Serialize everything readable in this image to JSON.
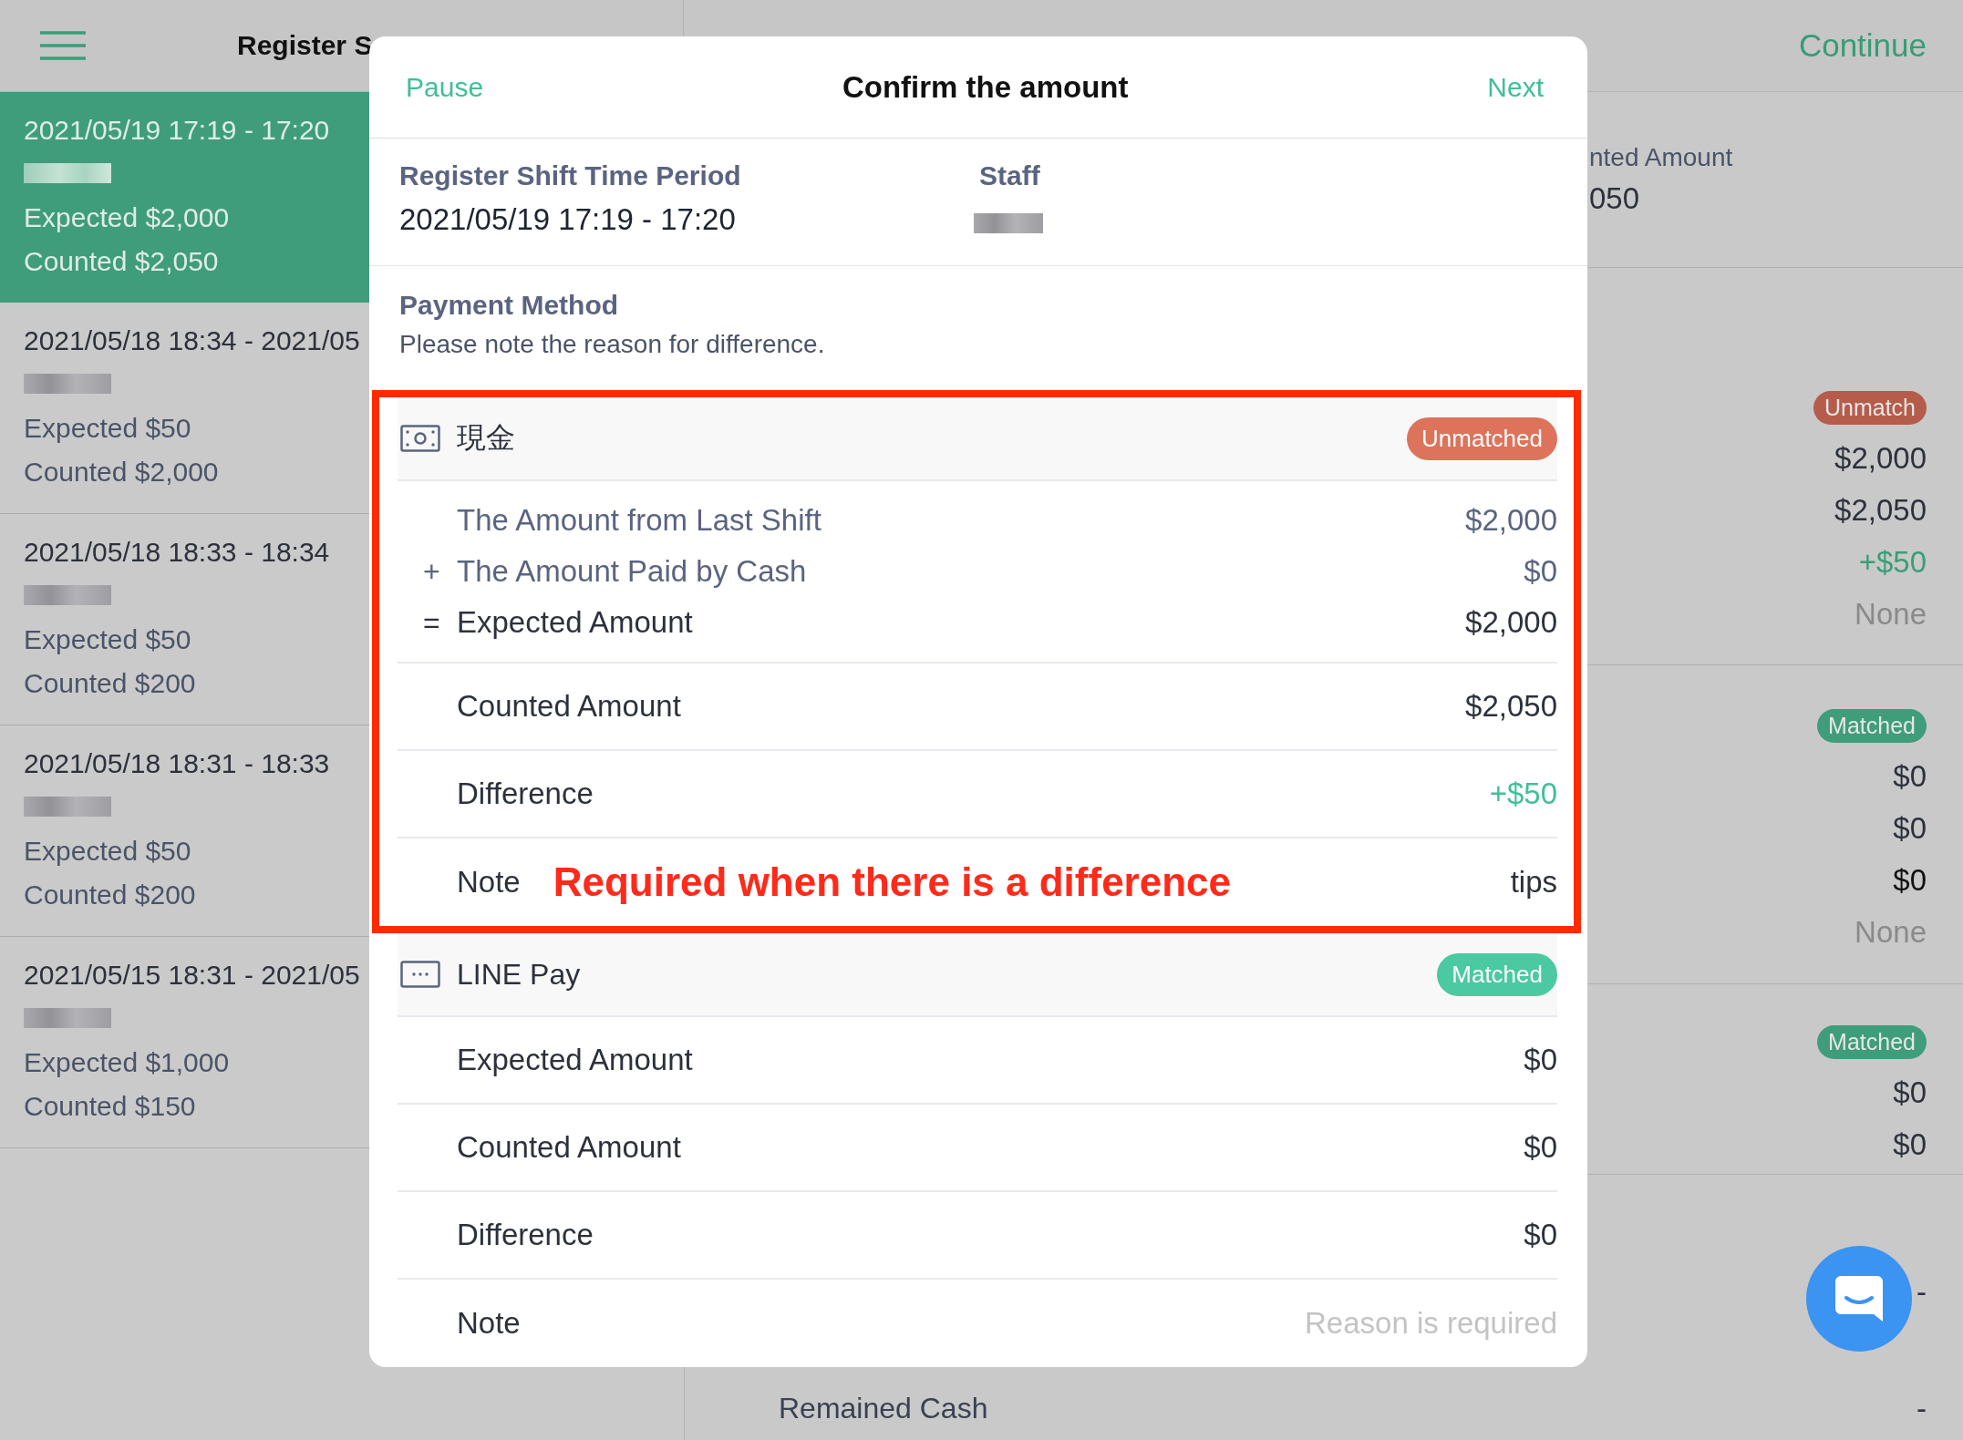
{
  "header": {
    "title": "Register S",
    "action": "Continue"
  },
  "sidebar": {
    "shifts": [
      {
        "period": "2021/05/19 17:19 - 17:20",
        "expected": "Expected $2,000",
        "counted": "Counted $2,050",
        "selected": true
      },
      {
        "period": "2021/05/18 18:34 - 2021/05",
        "expected": "Expected $50",
        "counted": "Counted $2,000",
        "selected": false
      },
      {
        "period": "2021/05/18 18:33 - 18:34",
        "expected": "Expected $50",
        "counted": "Counted $200",
        "selected": false
      },
      {
        "period": "2021/05/18 18:31 - 18:33",
        "expected": "Expected $50",
        "counted": "Counted $200",
        "selected": false
      },
      {
        "period": "2021/05/15 18:31 - 2021/05",
        "expected": "Expected $1,000",
        "counted": "Counted $150",
        "selected": false
      }
    ]
  },
  "detail": {
    "partial_label": "nted Amount",
    "partial_value": "050",
    "groups": [
      {
        "status": {
          "label": "Unmatch",
          "kind": "unmatched"
        },
        "values": [
          {
            "text": "$2,000",
            "kind": "plain"
          },
          {
            "text": "$2,050",
            "kind": "plain"
          },
          {
            "text": "+$50",
            "kind": "positive"
          },
          {
            "text": "None",
            "kind": "muted"
          }
        ]
      },
      {
        "status": {
          "label": "Matched",
          "kind": "matched"
        },
        "values": [
          {
            "text": "$0",
            "kind": "plain"
          },
          {
            "text": "$0",
            "kind": "plain"
          },
          {
            "text": "$0",
            "kind": "strong"
          },
          {
            "text": "None",
            "kind": "muted"
          }
        ]
      },
      {
        "status": {
          "label": "Matched",
          "kind": "matched"
        },
        "values": [
          {
            "text": "$0",
            "kind": "plain"
          },
          {
            "text": "$0",
            "kind": "plain"
          }
        ]
      },
      {
        "values": [
          {
            "text": "-",
            "kind": "plain"
          }
        ]
      }
    ],
    "footer": {
      "label": "Remained Cash",
      "value": "-"
    }
  },
  "dialog": {
    "pause": "Pause",
    "title": "Confirm the amount",
    "next": "Next",
    "period_label": "Register Shift Time Period",
    "period_value": "2021/05/19 17:19 - 17:20",
    "staff_label": "Staff",
    "section_title": "Payment Method",
    "section_hint": "Please note the reason for difference.",
    "methods": [
      {
        "name": "現金",
        "kind": "cash",
        "highlighted": true,
        "status": {
          "label": "Unmatched",
          "kind": "unmatched"
        },
        "breakdown": [
          {
            "label": "The Amount from Last Shift",
            "value": "$2,000",
            "kind": "term"
          },
          {
            "operator": "+",
            "label": "The Amount Paid by Cash",
            "value": "$0",
            "kind": "term"
          },
          {
            "operator": "=",
            "label": "Expected Amount",
            "value": "$2,000",
            "kind": "total"
          }
        ],
        "rows": [
          {
            "label": "Counted Amount",
            "value": "$2,050",
            "kind": "plain"
          },
          {
            "label": "Difference",
            "value": "+$50",
            "kind": "positive"
          },
          {
            "label": "Note",
            "value": "tips",
            "kind": "note",
            "annotation": "Required when there is a difference"
          }
        ]
      },
      {
        "name": "LINE Pay",
        "kind": "other",
        "highlighted": false,
        "status": {
          "label": "Matched",
          "kind": "matched"
        },
        "rows": [
          {
            "label": "Expected Amount",
            "value": "$0",
            "kind": "plain"
          },
          {
            "label": "Counted Amount",
            "value": "$0",
            "kind": "plain"
          },
          {
            "label": "Difference",
            "value": "$0",
            "kind": "plain"
          },
          {
            "label": "Note",
            "placeholder": "Reason is required",
            "kind": "note"
          }
        ]
      }
    ]
  }
}
